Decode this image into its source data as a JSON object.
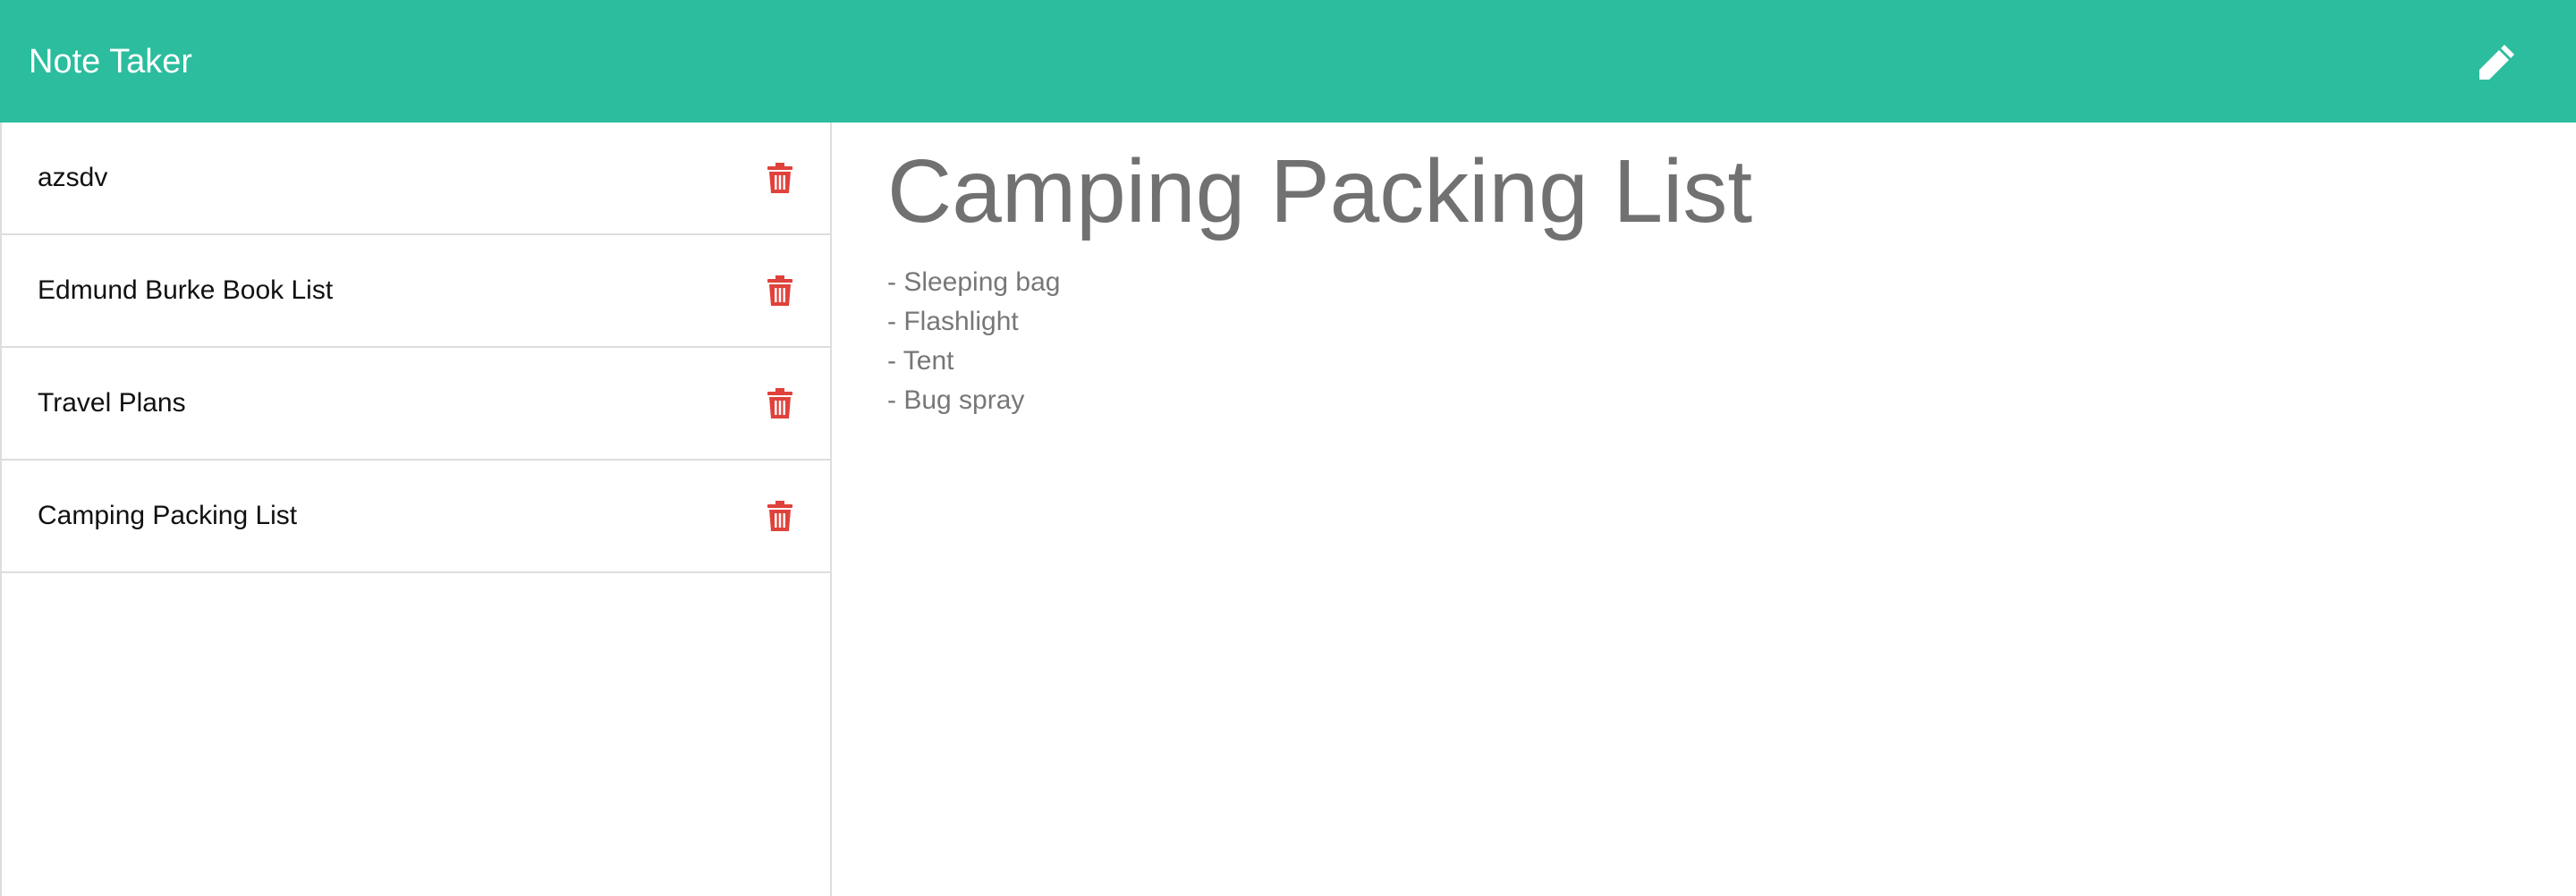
{
  "app": {
    "title": "Note Taker",
    "accent_color": "#2bbd9d",
    "new_note_icon": "pencil-icon"
  },
  "sidebar": {
    "notes": [
      {
        "title": "azsdv",
        "delete_icon": "trash-icon"
      },
      {
        "title": "Edmund Burke Book List",
        "delete_icon": "trash-icon"
      },
      {
        "title": "Travel Plans",
        "delete_icon": "trash-icon"
      },
      {
        "title": "Camping Packing List",
        "delete_icon": "trash-icon"
      }
    ],
    "delete_color": "#e0413b"
  },
  "main": {
    "note_title": "Camping Packing List",
    "note_lines": [
      "- Sleeping bag",
      "- Flashlight",
      "- Tent",
      "- Bug spray"
    ]
  }
}
